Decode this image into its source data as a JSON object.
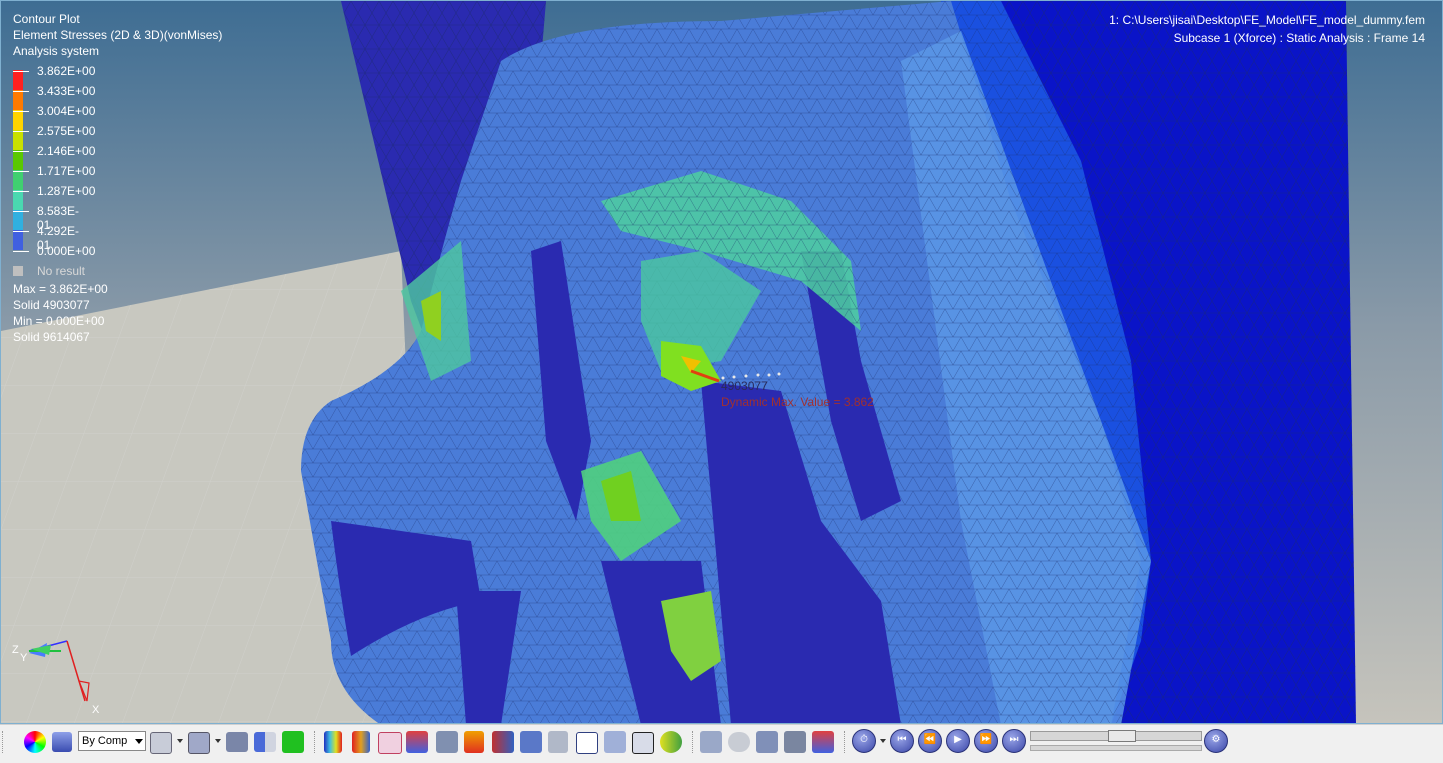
{
  "header": {
    "plot_type": "Contour Plot",
    "result_type": "Element Stresses (2D & 3D)(vonMises)",
    "system": "Analysis system"
  },
  "legend": {
    "entries": [
      {
        "label": "3.862E+00",
        "color": "#ff2020"
      },
      {
        "label": "3.433E+00",
        "color": "#ff7a00"
      },
      {
        "label": "3.004E+00",
        "color": "#ffd400"
      },
      {
        "label": "2.575E+00",
        "color": "#c8e000"
      },
      {
        "label": "2.146E+00",
        "color": "#5ac800"
      },
      {
        "label": "1.717E+00",
        "color": "#40d070"
      },
      {
        "label": "1.287E+00",
        "color": "#4ad8b0"
      },
      {
        "label": "8.583E-01",
        "color": "#30b0e0"
      },
      {
        "label": "4.292E-01",
        "color": "#4060e0"
      },
      {
        "label": "0.000E+00",
        "color": "#2020c0"
      }
    ],
    "no_result": "No result",
    "max_text": "Max = 3.862E+00",
    "max_elem": "Solid 4903077",
    "min_text": "Min = 0.000E+00",
    "min_elem": "Solid 9614067"
  },
  "model_info": {
    "file": "1: C:\\Users\\jisai\\Desktop\\FE_Model\\FE_model_dummy.fem",
    "subcase": "Subcase 1 (Xforce) : Static Analysis : Frame 14"
  },
  "annotation": {
    "element_id": "4903077",
    "dynamic_max": "Dynamic Max. Value = 3.862"
  },
  "axes": {
    "x": "X",
    "y": "Y",
    "z": "Z"
  },
  "toolbar": {
    "color_mode": "By Comp",
    "animation_progress": 0.55
  },
  "colors": {
    "bg_top": "#3e6d93",
    "bg_bottom": "#c8c8c0",
    "mesh_dark": "#2a2ab0",
    "mesh_mid": "#4a78d8",
    "mesh_light": "#5aa0e8",
    "mesh_green": "#4ed0a0"
  }
}
